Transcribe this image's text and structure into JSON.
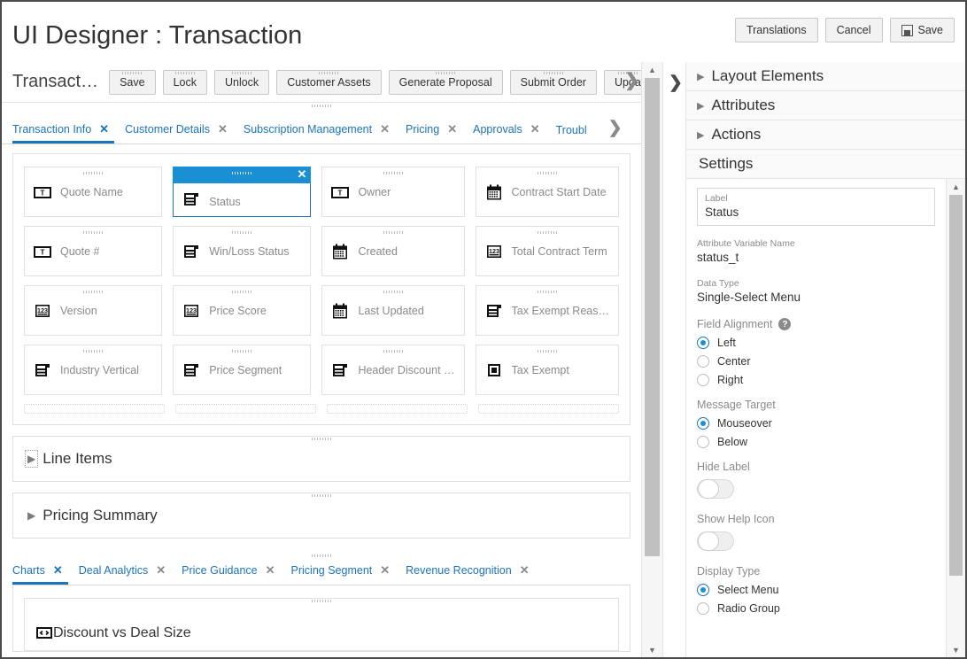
{
  "header": {
    "title": "UI Designer : Transaction",
    "actions": [
      {
        "label": "Translations",
        "icon": ""
      },
      {
        "label": "Cancel",
        "icon": ""
      },
      {
        "label": "Save",
        "icon": "floppy-disk-icon"
      }
    ]
  },
  "canvas": {
    "entity_name": "Transact…",
    "action_buttons": [
      "Save",
      "Lock",
      "Unlock",
      "Customer Assets",
      "Generate Proposal",
      "Submit Order",
      "Upda"
    ],
    "action_next_icon": "chevron-right-icon",
    "tabs": [
      {
        "label": "Transaction Info",
        "active": true
      },
      {
        "label": "Customer Details",
        "active": false
      },
      {
        "label": "Subscription Management",
        "active": false
      },
      {
        "label": "Pricing",
        "active": false
      },
      {
        "label": "Approvals",
        "active": false
      },
      {
        "label": "Troubl",
        "active": false
      }
    ],
    "tabs_next_icon": "chevron-right-icon",
    "fields": [
      {
        "label": "Quote Name",
        "icon": "text-field-icon",
        "selected": false
      },
      {
        "label": "Status",
        "icon": "select-menu-icon",
        "selected": true
      },
      {
        "label": "Owner",
        "icon": "text-field-icon",
        "selected": false
      },
      {
        "label": "Contract Start Date",
        "icon": "calendar-icon",
        "selected": false
      },
      {
        "label": "Quote #",
        "icon": "text-field-icon",
        "selected": false
      },
      {
        "label": "Win/Loss Status",
        "icon": "select-menu-icon",
        "selected": false
      },
      {
        "label": "Created",
        "icon": "calendar-icon",
        "selected": false
      },
      {
        "label": "Total Contract Term",
        "icon": "number-icon",
        "selected": false
      },
      {
        "label": "Version",
        "icon": "number-icon",
        "selected": false
      },
      {
        "label": "Price Score",
        "icon": "number-icon",
        "selected": false
      },
      {
        "label": "Last Updated",
        "icon": "calendar-icon",
        "selected": false
      },
      {
        "label": "Tax Exempt Reas…",
        "icon": "select-menu-icon",
        "selected": false
      },
      {
        "label": "Industry Vertical",
        "icon": "select-menu-icon",
        "selected": false
      },
      {
        "label": "Price Segment",
        "icon": "select-menu-icon",
        "selected": false
      },
      {
        "label": "Header Discount …",
        "icon": "select-menu-icon",
        "selected": false
      },
      {
        "label": "Tax Exempt",
        "icon": "checkbox-icon",
        "selected": false
      }
    ],
    "sections": [
      {
        "title": "Line Items",
        "icon": "caret-right-icon",
        "focused": true
      },
      {
        "title": "Pricing Summary",
        "icon": "caret-right-icon",
        "focused": false
      }
    ],
    "bottom_tabs": [
      {
        "label": "Charts",
        "active": true
      },
      {
        "label": "Deal Analytics",
        "active": false
      },
      {
        "label": "Price Guidance",
        "active": false
      },
      {
        "label": "Pricing Segment",
        "active": false
      },
      {
        "label": "Revenue Recognition",
        "active": false
      }
    ],
    "chart_tile": {
      "label": "Discount vs Deal Size",
      "icon": "embed-code-icon"
    }
  },
  "splitter": {
    "icon": "chevron-right-icon"
  },
  "properties": {
    "accordions": [
      {
        "label": "Layout Elements",
        "icon": "caret-right-icon",
        "collapsible": true
      },
      {
        "label": "Attributes",
        "icon": "caret-right-icon",
        "collapsible": true
      },
      {
        "label": "Actions",
        "icon": "caret-right-icon",
        "collapsible": true
      },
      {
        "label": "Settings",
        "icon": "",
        "collapsible": false
      }
    ],
    "settings": {
      "label_field": {
        "label": "Label",
        "value": "Status"
      },
      "attribute_variable_name": {
        "label": "Attribute Variable Name",
        "value": "status_t"
      },
      "data_type": {
        "label": "Data Type",
        "value": "Single-Select Menu"
      },
      "field_alignment": {
        "label": "Field Alignment",
        "help_icon": "help-icon",
        "options": [
          {
            "label": "Left",
            "selected": true
          },
          {
            "label": "Center",
            "selected": false
          },
          {
            "label": "Right",
            "selected": false
          }
        ]
      },
      "message_target": {
        "label": "Message Target",
        "options": [
          {
            "label": "Mouseover",
            "selected": true
          },
          {
            "label": "Below",
            "selected": false
          }
        ]
      },
      "hide_label": {
        "label": "Hide Label",
        "on": false
      },
      "show_help_icon": {
        "label": "Show Help Icon",
        "on": false
      },
      "display_type": {
        "label": "Display Type",
        "options": [
          {
            "label": "Select Menu",
            "selected": true
          },
          {
            "label": "Radio Group",
            "selected": false
          }
        ]
      }
    }
  },
  "colors": {
    "accent": "#1b74bb",
    "selected_header": "#1b8fd4",
    "border": "#e0e0e0",
    "muted_text": "#8a8a8a"
  }
}
